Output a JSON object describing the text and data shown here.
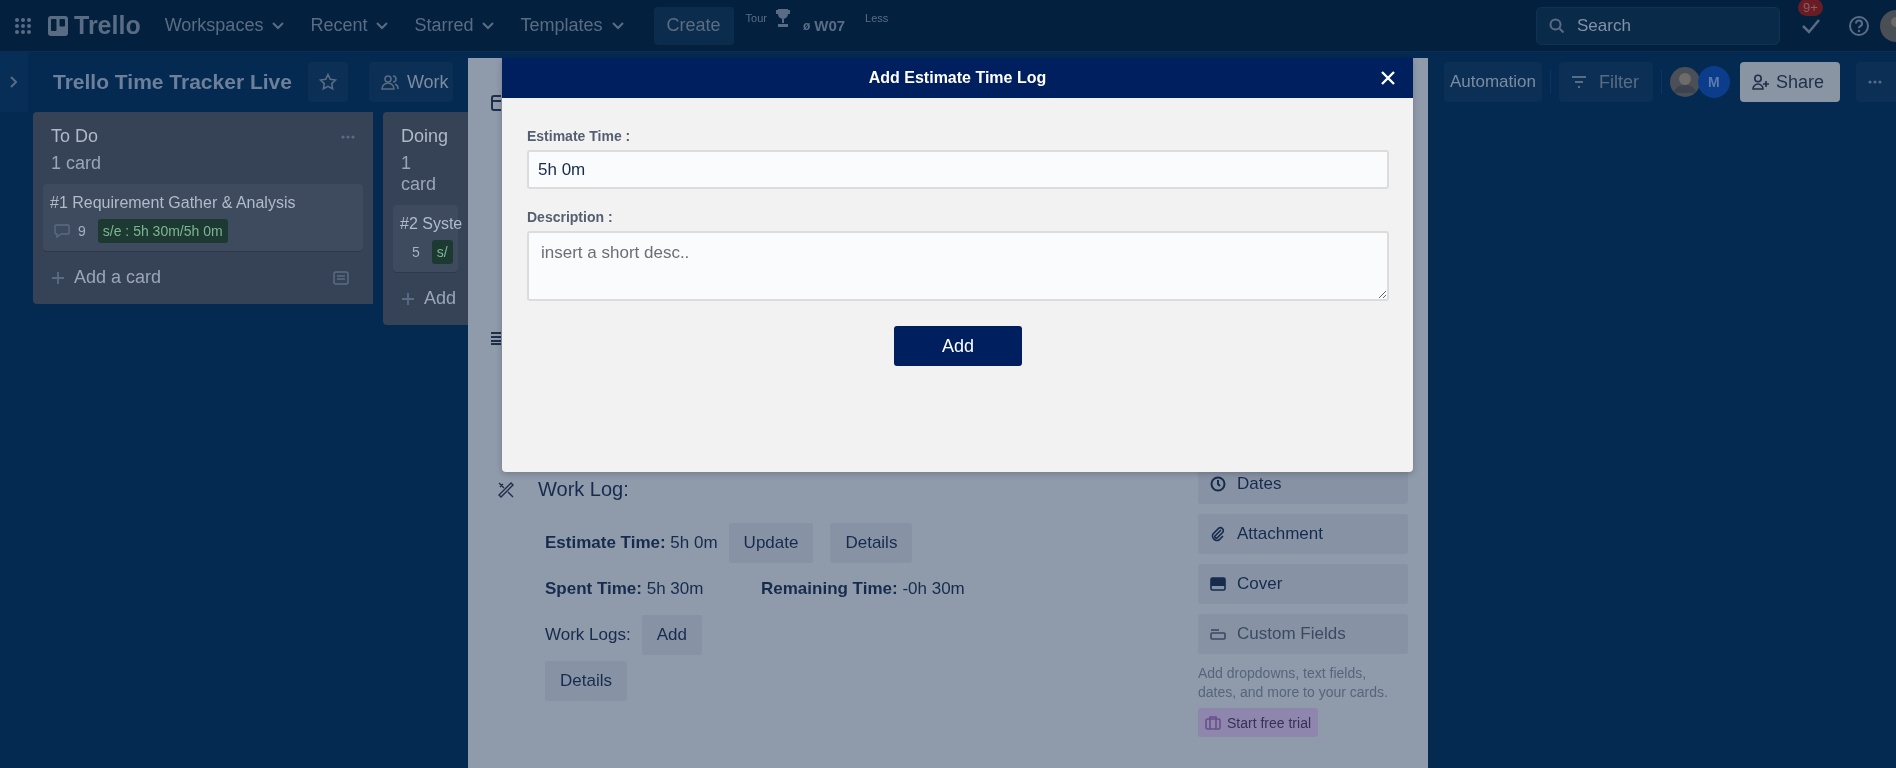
{
  "top_bar": {
    "logo": "Trello",
    "menus": [
      {
        "label": "Workspaces"
      },
      {
        "label": "Recent"
      },
      {
        "label": "Starred"
      },
      {
        "label": "Templates"
      }
    ],
    "create": "Create",
    "tour": "Tour",
    "tracker_mark": "ø",
    "workspace_code": "W07",
    "less": "Less",
    "search": {
      "placeholder": "Search"
    },
    "notifications": "9+"
  },
  "board_header": {
    "title": "Trello Time Tracker Live",
    "workspace_button": "Work",
    "automation": "Automation",
    "filter": "Filter",
    "member_initial": "M",
    "share": "Share"
  },
  "lists": [
    {
      "title": "To Do",
      "count": "1 card",
      "cards": [
        {
          "title": "#1 Requirement Gather & Analysis",
          "comments": "9",
          "time_badge": "s/e : 5h 30m/5h 0m"
        }
      ],
      "add_card": "Add a card"
    },
    {
      "title": "Doing",
      "count": "1 card",
      "cards": [
        {
          "title": "#2 Syste",
          "comments": "5",
          "time_badge": "s/"
        }
      ],
      "add_card": "Add"
    }
  ],
  "card_detail": {
    "work_log": {
      "heading": "Work Log:",
      "estimate_label": "Estimate Time:",
      "estimate_value": "5h 0m",
      "buttons": [
        "Update",
        "Details"
      ],
      "spent_label": "Spent Time:",
      "spent_value": "5h 30m",
      "remaining_label": "Remaining Time:",
      "remaining_value": "-0h 30m",
      "logs_label": "Work Logs:",
      "add": "Add",
      "details": "Details"
    },
    "sidebar": {
      "items": [
        {
          "label": "Dates",
          "disabled": false
        },
        {
          "label": "Attachment",
          "disabled": false
        },
        {
          "label": "Cover",
          "disabled": false
        },
        {
          "label": "Custom Fields",
          "disabled": true
        }
      ],
      "hint": "Add dropdowns, text fields, dates, and more to your cards.",
      "trial": "Start free trial"
    }
  },
  "dialog": {
    "title": "Add Estimate Time Log",
    "fields": [
      {
        "kind": "input",
        "label": "Estimate Time :",
        "value": "5h 0m"
      },
      {
        "kind": "textarea",
        "label": "Description :",
        "placeholder": "insert a short desc.."
      }
    ],
    "submit": "Add"
  }
}
